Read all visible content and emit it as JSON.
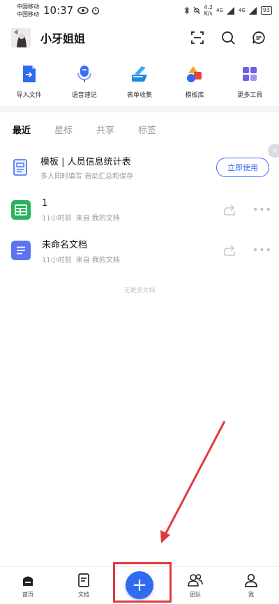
{
  "status_bar": {
    "carrier1": "中国移动",
    "carrier2": "中国移动",
    "time": "10:37",
    "speed_value": "4.2",
    "speed_unit": "K/s",
    "signal1": "4G",
    "signal2": "4G",
    "battery": "93"
  },
  "header": {
    "username": "小牙姐姐",
    "icons": [
      "scan-icon",
      "search-icon",
      "message-icon"
    ]
  },
  "tools": [
    {
      "label": "导入文件",
      "icon": "import-file-icon",
      "color": "#2f6bf0"
    },
    {
      "label": "语音速记",
      "icon": "microphone-icon",
      "color": "#3b6ff2"
    },
    {
      "label": "表单收集",
      "icon": "form-icon",
      "color": "#1e88e5"
    },
    {
      "label": "模板库",
      "icon": "template-icon",
      "color": "#f4a320"
    },
    {
      "label": "更多工具",
      "icon": "grid-icon",
      "color": "#6a63e0"
    }
  ],
  "tabs": [
    {
      "label": "最近",
      "active": true
    },
    {
      "label": "星标",
      "active": false
    },
    {
      "label": "共享",
      "active": false
    },
    {
      "label": "标签",
      "active": false
    }
  ],
  "template_card": {
    "title": "模板 | 人员信息统计表",
    "subtitle": "多人同时填写 自动汇总和保存",
    "button": "立即使用",
    "close": "×"
  },
  "documents": [
    {
      "title": "1",
      "time": "11小时前",
      "source": "来自 我的文档",
      "icon": "spreadsheet-icon",
      "color": "#27b35a"
    },
    {
      "title": "未命名文档",
      "time": "11小时前",
      "source": "来自 我的文档",
      "icon": "document-icon",
      "color": "#5b74f0"
    }
  ],
  "no_more": "无更多文档",
  "bottom_nav": [
    {
      "label": "首页",
      "icon": "home-icon"
    },
    {
      "label": "文档",
      "icon": "docs-icon"
    },
    {
      "label": "",
      "icon": "plus-icon"
    },
    {
      "label": "团队",
      "icon": "team-icon"
    },
    {
      "label": "我",
      "icon": "profile-icon"
    }
  ],
  "fab_symbol": "+",
  "accent_color": "#2f6bf0",
  "annotation_color": "#e03a3e"
}
